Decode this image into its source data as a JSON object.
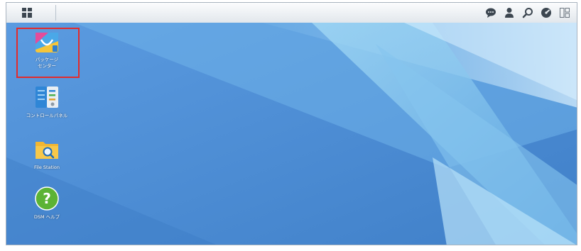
{
  "taskbar": {
    "main_menu_icon": "grid-menu-icon",
    "right_icons": [
      "chat-bubble-icon",
      "user-icon",
      "search-icon",
      "dashboard-icon",
      "widgets-icon"
    ]
  },
  "desktop": {
    "shortcuts": [
      {
        "id": "package-center",
        "label": "パッケージ\nセンター",
        "icon": "shopping-bag-icon",
        "highlighted": true
      },
      {
        "id": "control-panel",
        "label": "コントロールパネル",
        "icon": "control-panel-icon"
      },
      {
        "id": "file-station",
        "label": "File Station",
        "icon": "folder-search-icon"
      },
      {
        "id": "dsm-help",
        "label": "DSM ヘルプ",
        "icon": "help-icon"
      }
    ]
  },
  "colors": {
    "highlight": "#e32b2b",
    "desktop_base": "#4f8fd4",
    "help_green": "#5cb335",
    "folder_yellow": "#f2b632"
  }
}
